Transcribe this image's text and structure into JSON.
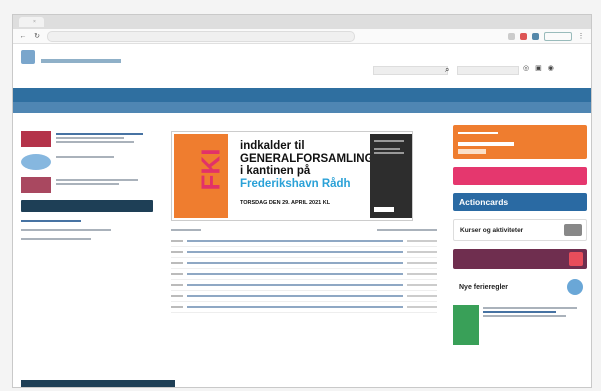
{
  "browser": {
    "tab_title": "",
    "tab_close": "×",
    "url": ""
  },
  "site": {
    "name": "",
    "search_placeholder": "",
    "header_icons": [
      "globe-icon",
      "lock-icon",
      "user-icon"
    ]
  },
  "nav": {
    "items": [
      "",
      "",
      "",
      "",
      "",
      "",
      "",
      ""
    ],
    "subnav": ""
  },
  "left": {
    "section_title": "",
    "news_small_text": "",
    "link_text": "",
    "button_label": "",
    "section2_title": "",
    "footer_label": ""
  },
  "mid": {
    "section_title": "",
    "banner": {
      "logo": "FKI",
      "line1": "indkalder til",
      "line2": "GENERALFORSAMLING",
      "line3": "i kantinen på",
      "line4": "Frederikshavn Rådh",
      "date": "TORSDAG DEN 29. APRIL 2021 KL"
    },
    "list_title": ""
  },
  "right": {
    "facebook_label": "",
    "actioncards_label": "Actioncards",
    "kurser_label": "Kurser og aktiviteter",
    "ferie_label": "Nye ferieregler",
    "it_section_title": ""
  },
  "colors": {
    "nav_blue": "#2f6fa0",
    "orange": "#ef7d2f",
    "pink": "#e5376e",
    "dark_navy": "#1e3f56"
  }
}
